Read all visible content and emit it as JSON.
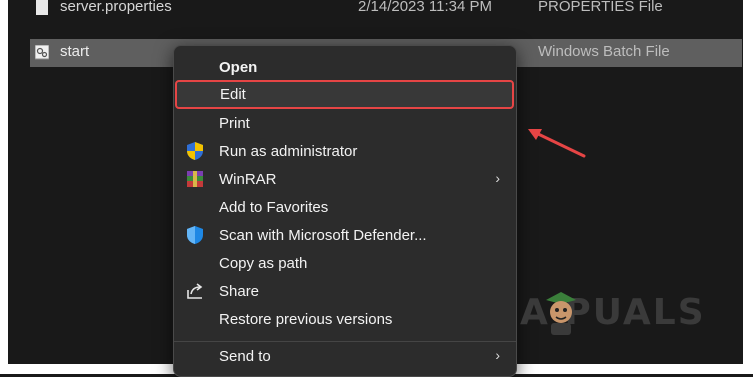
{
  "files": [
    {
      "name": "server.properties",
      "date": "2/14/2023 11:34 PM",
      "type": "PROPERTIES File"
    },
    {
      "name": "start",
      "date": "",
      "type": "Windows Batch File"
    }
  ],
  "context_menu": {
    "items": [
      {
        "label": "Open",
        "bold": true
      },
      {
        "label": "Edit",
        "highlighted": true
      },
      {
        "label": "Print"
      },
      {
        "label": "Run as administrator",
        "icon": "shield-icon"
      },
      {
        "label": "WinRAR",
        "icon": "winrar-icon",
        "submenu": true
      },
      {
        "label": "Add to Favorites"
      },
      {
        "label": "Scan with Microsoft Defender...",
        "icon": "defender-icon"
      },
      {
        "label": "Copy as path"
      },
      {
        "label": "Share",
        "icon": "share-icon"
      },
      {
        "label": "Restore previous versions"
      },
      {
        "label": "Send to",
        "submenu": true
      }
    ],
    "chevron": "›"
  },
  "watermark": {
    "text": "A PUALS"
  },
  "colors": {
    "highlight_border": "#e64545",
    "arrow": "#e64545",
    "menu_bg": "#2c2c2c"
  }
}
